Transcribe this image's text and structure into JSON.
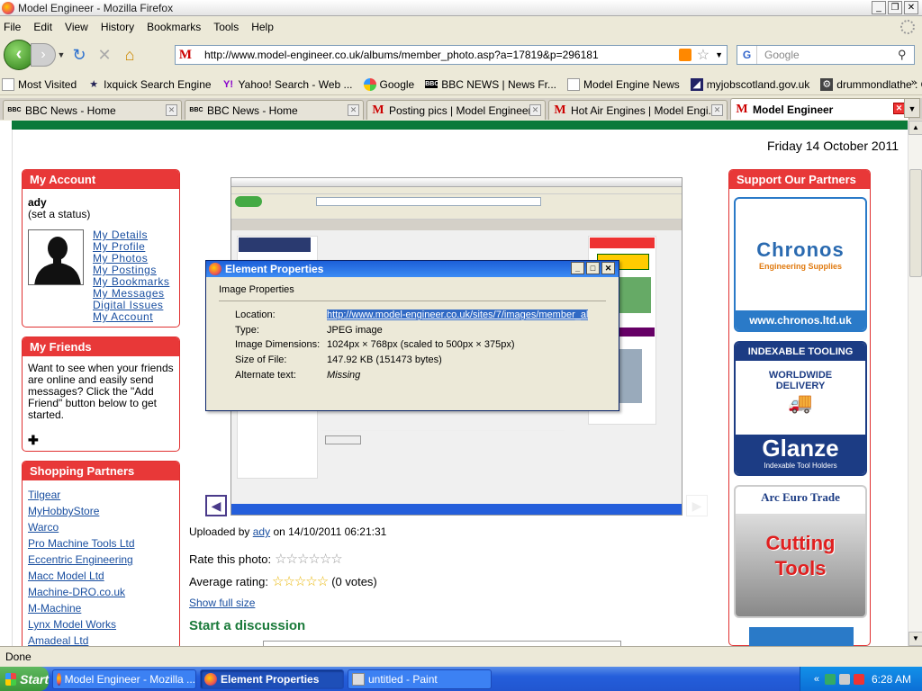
{
  "window": {
    "title": "Model Engineer - Mozilla Firefox",
    "buttons": [
      "_",
      "❐",
      "✕"
    ]
  },
  "menu": [
    "File",
    "Edit",
    "View",
    "History",
    "Bookmarks",
    "Tools",
    "Help"
  ],
  "nav": {
    "url": "http://www.model-engineer.co.uk/albums/member_photo.asp?a=17819&p=296181",
    "search_placeholder": "Google",
    "search_engine_letter": "G"
  },
  "bookmarks": [
    {
      "label": "Most Visited",
      "icon": "page-icon"
    },
    {
      "label": "Ixquick Search Engine",
      "icon": "star-icon"
    },
    {
      "label": "Yahoo! Search - Web ...",
      "icon": "yahoo-icon"
    },
    {
      "label": "Google",
      "icon": "google-icon"
    },
    {
      "label": "BBC NEWS | News Fr...",
      "icon": "bbc-icon"
    },
    {
      "label": "Model Engine News",
      "icon": "page-icon"
    },
    {
      "label": "myjobscotland.gov.uk",
      "icon": "job-icon"
    },
    {
      "label": "drummondlathe : Ow...",
      "icon": "lathe-icon"
    }
  ],
  "tabs": [
    {
      "label": "BBC News - Home",
      "icon": "BBC",
      "active": false
    },
    {
      "label": "BBC News - Home",
      "icon": "BBC",
      "active": false
    },
    {
      "label": "Posting pics | Model Engineer",
      "icon": "M",
      "active": false
    },
    {
      "label": "Hot Air Engines | Model Engi...",
      "icon": "M",
      "active": false
    },
    {
      "label": "Model Engineer",
      "icon": "M",
      "active": true
    }
  ],
  "page": {
    "date": "Friday 14 October 2011",
    "my_account": {
      "title": "My Account",
      "username": "ady",
      "status": "(set a status)",
      "links": [
        "My Details",
        "My Profile",
        "My Photos",
        "My Postings",
        "My Bookmarks",
        "My Messages",
        "Digital Issues",
        "My Account"
      ]
    },
    "my_friends": {
      "title": "My Friends",
      "text": "Want to see when your friends are online and easily send messages? Click the \"Add Friend\" button below to get started."
    },
    "shopping": {
      "title": "Shopping Partners",
      "links": [
        "Tilgear",
        "MyHobbyStore",
        "Warco",
        "Pro Machine Tools Ltd",
        "Eccentric Engineering",
        "Macc Model Ltd",
        "Machine-DRO.co.uk",
        "M-Machine",
        "Lynx Model Works",
        "Amadeal Ltd"
      ]
    },
    "photo": {
      "uploaded_prefix": "Uploaded by",
      "uploader": "ady",
      "uploaded_suffix": "on 14/10/2011 06:21:31",
      "rate_label": "Rate this photo:",
      "avg_label": "Average rating:",
      "votes": "(0 votes)",
      "rating_stars": 0,
      "show_full": "Show full size",
      "discussion": "Start a discussion"
    },
    "dialog": {
      "title": "Element Properties",
      "subtitle": "Image Properties",
      "rows": [
        {
          "label": "Location:",
          "value": "http://www.model-engineer.co.uk/sites/7/images/member_al"
        },
        {
          "label": "Type:",
          "value": "JPEG image"
        },
        {
          "label": "Image Dimensions:",
          "value": "1024px × 768px (scaled to 500px × 375px)"
        },
        {
          "label": "Size of File:",
          "value": "147.92 KB (151473 bytes)"
        },
        {
          "label": "Alternate text:",
          "value": "Missing"
        }
      ]
    },
    "partners": {
      "title": "Support Our Partners",
      "chronos": {
        "name": "Chronos",
        "tag": "Engineering Supplies",
        "url": "www.chronos.ltd.uk"
      },
      "glanze": {
        "top": "INDEXABLE TOOLING",
        "mid1": "WORLDWIDE",
        "mid2": "DELIVERY",
        "name": "Glanze",
        "tag": "Indexable Tool Holders"
      },
      "arc": {
        "name": "Arc Euro Trade",
        "line1": "Cutting",
        "line2": "Tools"
      }
    }
  },
  "status": "Done",
  "taskbar": {
    "start": "Start",
    "tasks": [
      "Model Engineer - Mozilla ...",
      "Element Properties",
      "untitled - Paint"
    ],
    "clock": "6:28 AM"
  }
}
